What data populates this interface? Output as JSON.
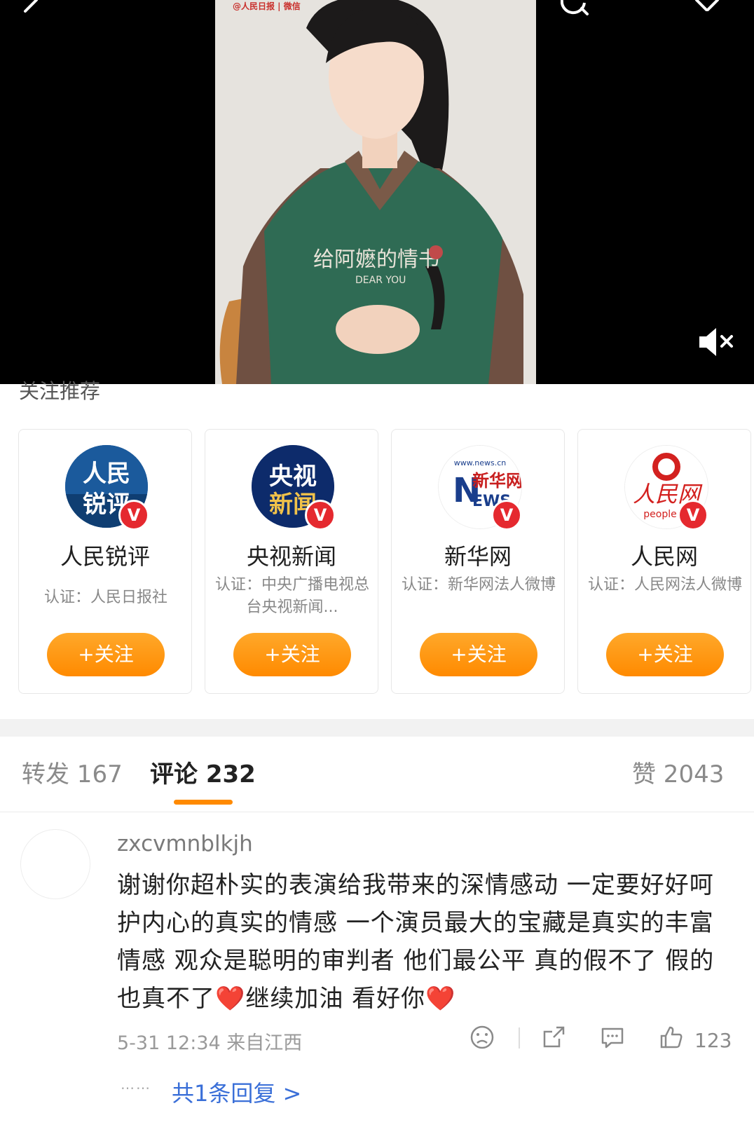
{
  "video": {
    "watermark": "@人民日报 | 微信",
    "shirt_text": "给阿嬷的情书",
    "shirt_sub": "DEAR YOU"
  },
  "recommend": {
    "title": "关注推荐",
    "cards": [
      {
        "name": "人民锐评",
        "cert": "认证：人民日报社",
        "follow": "+关注",
        "avatar_text": "人民锐评",
        "avatar_color": "#1b4f8c"
      },
      {
        "name": "央视新闻",
        "cert": "认证：中央广播电视总台央视新闻...",
        "follow": "+关注",
        "avatar_text": "央视新闻",
        "avatar_color": "#0d2b6b"
      },
      {
        "name": "新华网",
        "cert": "认证：新华网法人微博",
        "follow": "+关注",
        "avatar_text": "新华网 NEWS",
        "avatar_color": "#ffffff"
      },
      {
        "name": "人民网",
        "cert": "认证：人民网法人微博",
        "follow": "+关注",
        "avatar_text": "人民网 people",
        "avatar_color": "#ffffff"
      }
    ]
  },
  "tabs": {
    "repost": "转发 167",
    "comment": "评论 232",
    "like": "赞 2043"
  },
  "comment": {
    "user": "zxcvmnblkjh",
    "text": "谢谢你超朴实的表演给我带来的深情感动 一定要好好呵护内心的真实的情感 一个演员最大的宝藏是真实的丰富情感   观众是聪明的审判者 他们最公平 真的假不了 假的也真不了❤️继续加油 看好你❤️",
    "meta": "5-31 12:34  来自江西",
    "likes": "123",
    "reply_dots": "……",
    "reply_link": "共1条回复 >"
  },
  "colors": {
    "accent": "#ff8a00",
    "verified": "#e5292f",
    "link": "#3a6fd8"
  }
}
